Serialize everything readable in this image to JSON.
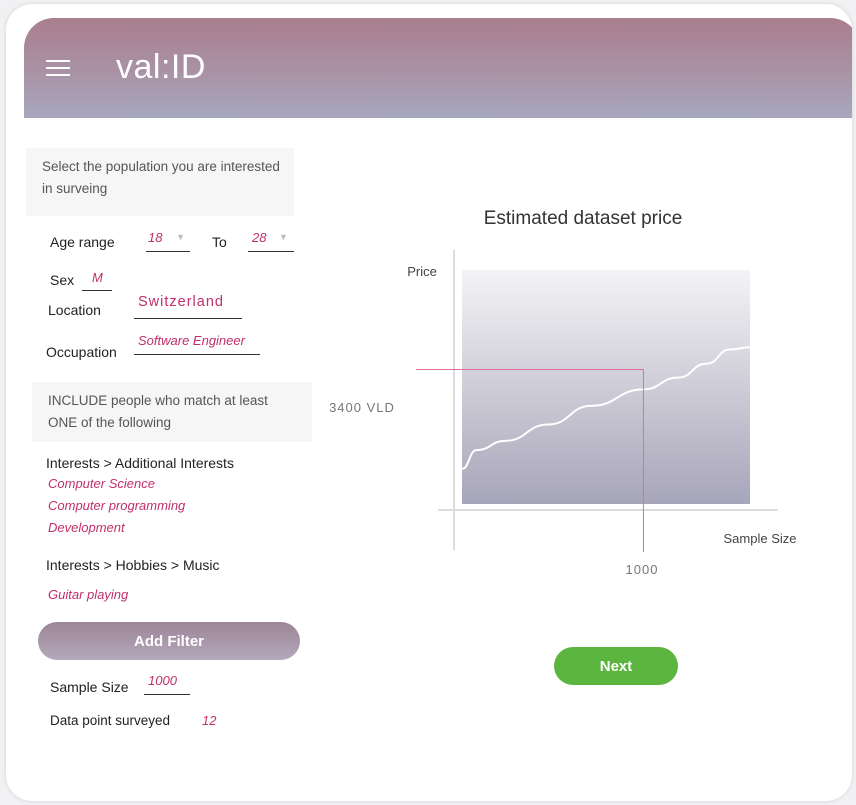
{
  "app": {
    "title": "val:ID"
  },
  "intro_text": "Select the population you are interested in surveing",
  "filters": {
    "age_label": "Age range",
    "age_from": "18",
    "age_to_label": "To",
    "age_to": "28",
    "sex_label": "Sex",
    "sex_value": "M",
    "location_label": "Location",
    "location_value": "Switzerland",
    "occupation_label": "Occupation",
    "occupation_value": "Software Engineer"
  },
  "include_text": "INCLUDE people who match at least ONE of the following",
  "interest_groups": [
    {
      "path": "Interests > Additional Interests",
      "items": [
        "Computer Science",
        "Computer programming",
        "Development"
      ]
    },
    {
      "path": "Interests > Hobbies > Music",
      "items": [
        "Guitar playing"
      ]
    }
  ],
  "add_filter_label": "Add Filter",
  "sample": {
    "size_label": "Sample Size",
    "size_value": "1000",
    "surveyed_label": "Data point surveyed",
    "surveyed_value": "12"
  },
  "next_label": "Next",
  "chart_data": {
    "type": "line",
    "title": "Estimated dataset price",
    "ylabel": "Price",
    "xlabel": "Sample Size",
    "marker": {
      "x_label": "1000",
      "y_label": "3400 VLD",
      "x_frac": 0.63,
      "y_frac": 0.425
    },
    "curve_frac": [
      [
        0.0,
        0.85
      ],
      [
        0.05,
        0.77
      ],
      [
        0.15,
        0.73
      ],
      [
        0.3,
        0.66
      ],
      [
        0.45,
        0.58
      ],
      [
        0.63,
        0.51
      ],
      [
        0.75,
        0.46
      ],
      [
        0.85,
        0.4
      ],
      [
        0.93,
        0.34
      ],
      [
        1.0,
        0.33
      ]
    ],
    "grid": false
  },
  "colors": {
    "accent": "#c0306a",
    "next": "#5bb53f",
    "marker": "#e46a9c"
  }
}
